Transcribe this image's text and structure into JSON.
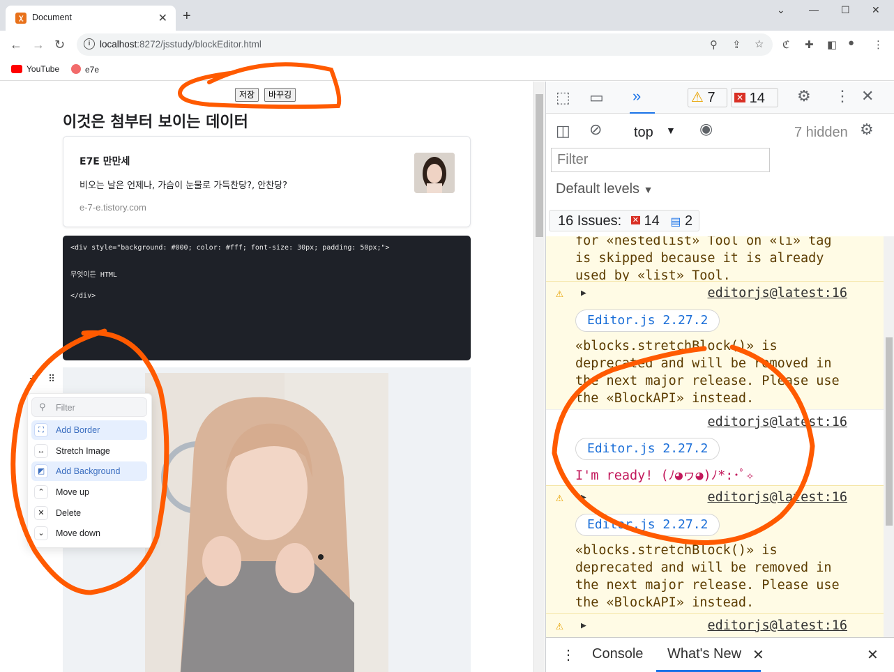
{
  "browser": {
    "tab_title": "Document",
    "tab_close": "✕",
    "new_tab": "+",
    "url_host": "localhost",
    "url_path": ":8272/jsstudy/blockEditor.html",
    "bookmarks": [
      {
        "label": "YouTube",
        "color": "#ff0000"
      },
      {
        "label": "e7e",
        "color": "#f26b6b"
      }
    ]
  },
  "page": {
    "buttons": {
      "save": "저장",
      "change": "바꾸깅"
    },
    "heading": "이것은 첨부터 보이는 데이터",
    "link_card": {
      "title": "E7E 만만세",
      "description": "비오는 날은 언제나, 가슴이 눈물로 가득찬당?, 안찬당?",
      "url": "e-7-e.tistory.com"
    },
    "code_lines": [
      "<div style=\"background: #000; color: #fff; font-size: 30px; padding: 50px;\">",
      "무엇이든 HTML",
      "</div>"
    ],
    "tunes": {
      "filter_placeholder": "Filter",
      "items": [
        {
          "label": "Add Border",
          "icon": "border-icon",
          "glyph": "⛶",
          "active": true
        },
        {
          "label": "Stretch Image",
          "icon": "stretch-icon",
          "glyph": "↔",
          "active": false
        },
        {
          "label": "Add Background",
          "icon": "background-icon",
          "glyph": "◩",
          "active": true
        },
        {
          "label": "Move up",
          "icon": "chevron-up-icon",
          "glyph": "⌃",
          "active": false
        },
        {
          "label": "Delete",
          "icon": "close-icon",
          "glyph": "✕",
          "active": false
        },
        {
          "label": "Move down",
          "icon": "chevron-down-icon",
          "glyph": "⌄",
          "active": false
        }
      ]
    }
  },
  "devtools": {
    "warnings_count": "7",
    "errors_count": "14",
    "context": "top",
    "hidden": "7 hidden",
    "filter_placeholder": "Filter",
    "levels": "Default levels",
    "issues": {
      "label": "16 Issues:",
      "errors": "14",
      "info": "2"
    },
    "messages": [
      {
        "type": "warn",
        "lines": [
          "for «nestedlist» Tool on «li» tag",
          "is skipped because it is already",
          "used by «list» Tool."
        ]
      },
      {
        "type": "warn",
        "source": "editorjs@latest:16",
        "pill": "Editor.js 2.27.2",
        "lines": [
          " «blocks.stretchBlock()» is",
          "deprecated and will be removed in",
          "the next major release. Please use",
          "the «BlockAPI» instead."
        ]
      },
      {
        "type": "info",
        "source": "editorjs@latest:16",
        "pill": "Editor.js 2.27.2",
        "lines": [
          " I'm ready! (ﾉ◕ヮ◕)ﾉ*:･ﾟ✧"
        ]
      },
      {
        "type": "warn",
        "source": "editorjs@latest:16",
        "pill": "Editor.js 2.27.2",
        "lines": [
          " «blocks.stretchBlock()» is",
          "deprecated and will be removed in",
          "the next major release. Please use",
          "the «BlockAPI» instead."
        ]
      },
      {
        "type": "warn",
        "source": "editorjs@latest:16",
        "lines": []
      }
    ],
    "drawer_tabs": [
      "Console",
      "What's New"
    ]
  },
  "colors": {
    "annotation": "#ff5a00",
    "accent": "#1a73e8"
  }
}
